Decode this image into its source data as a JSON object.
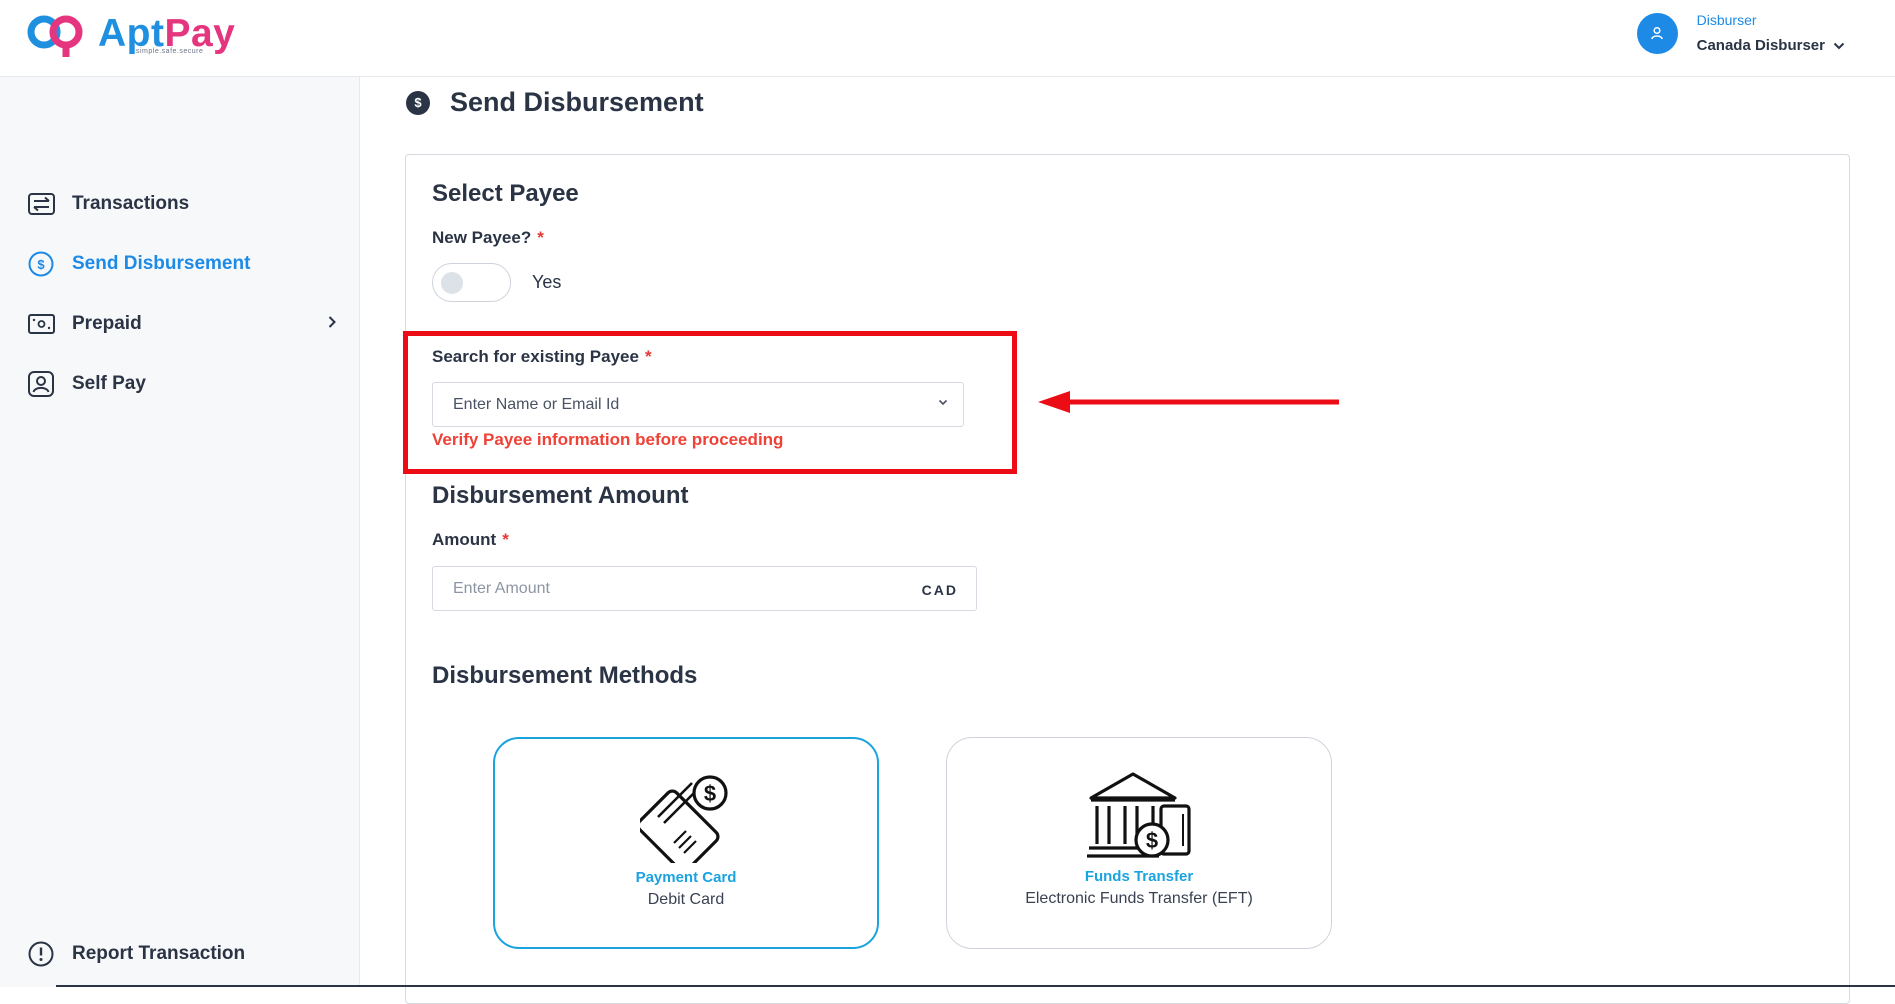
{
  "header": {
    "logo": {
      "word_part1": "Apt",
      "word_part2": "Pay",
      "tagline": "simple.safe.secure"
    },
    "user": {
      "role": "Disburser",
      "name": "Canada Disburser"
    }
  },
  "sidebar": {
    "items": [
      {
        "label": "Transactions",
        "icon": "transfer-arrows-icon",
        "active": false
      },
      {
        "label": "Send Disbursement",
        "icon": "dollar-circle-icon",
        "active": true
      },
      {
        "label": "Prepaid",
        "icon": "cash-icon",
        "active": false,
        "has_submenu": true
      },
      {
        "label": "Self Pay",
        "icon": "user-badge-icon",
        "active": false
      }
    ],
    "footer_item": {
      "label": "Report Transaction",
      "icon": "alert-circle-icon"
    }
  },
  "main": {
    "title_icon": "$",
    "title": "Send Disbursement",
    "select_payee": {
      "heading": "Select Payee",
      "new_payee_label": "New Payee?",
      "required_mark": "*",
      "toggle_text": "Yes",
      "toggle_on": false,
      "search_label": "Search for existing Payee",
      "search_placeholder": "Enter Name or Email Id",
      "warning": "Verify Payee information before proceeding"
    },
    "amount": {
      "heading": "Disbursement Amount",
      "label": "Amount",
      "placeholder": "Enter Amount",
      "currency": "CAD"
    },
    "methods": {
      "heading": "Disbursement Methods",
      "items": [
        {
          "title": "Payment Card",
          "subtitle": "Debit Card",
          "icon": "payment-card-icon",
          "selected": true
        },
        {
          "title": "Funds Transfer",
          "subtitle": "Electronic Funds Transfer (EFT)",
          "icon": "bank-transfer-icon",
          "selected": false
        }
      ]
    }
  },
  "colors": {
    "accent": "#1d8ae6",
    "method_accent": "#1ba3e0",
    "error": "#ef4136",
    "annotation_red": "#ec0c16",
    "text": "#2b3445"
  }
}
